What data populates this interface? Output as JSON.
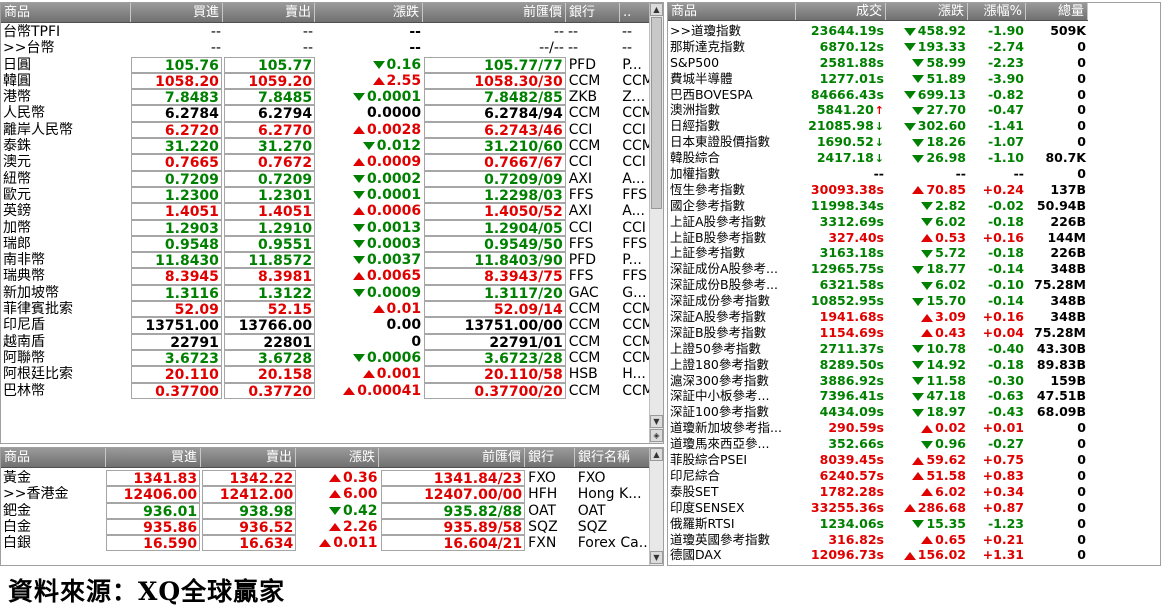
{
  "fx_panel": {
    "headers": [
      "商品",
      "買進",
      "賣出",
      "漲跌",
      "前匯價",
      "銀行",
      ".."
    ],
    "rows": [
      {
        "name": "台幣TPFI",
        "bid": "--",
        "ask": "--",
        "chg": "--",
        "prev": "--",
        "bank": "--",
        "bank2": "--",
        "dir": "none"
      },
      {
        "name": ">>台幣",
        "bid": "--",
        "ask": "--",
        "chg": "--",
        "prev": "--/--",
        "bank": "--",
        "bank2": "--",
        "dir": "none"
      },
      {
        "name": "日圓",
        "bid": "105.76",
        "ask": "105.77",
        "chg": "0.16",
        "prev": "105.77/77",
        "bank": "PFD",
        "bank2": "P...",
        "dir": "down"
      },
      {
        "name": "韓圓",
        "bid": "1058.20",
        "ask": "1059.20",
        "chg": "2.55",
        "prev": "1058.30/30",
        "bank": "CCM",
        "bank2": "CCM",
        "dir": "up"
      },
      {
        "name": "港幣",
        "bid": "7.8483",
        "ask": "7.8485",
        "chg": "0.0001",
        "prev": "7.8482/85",
        "bank": "ZKB",
        "bank2": "Z...",
        "dir": "down"
      },
      {
        "name": "人民幣",
        "bid": "6.2784",
        "ask": "6.2794",
        "chg": "0.0000",
        "prev": "6.2784/94",
        "bank": "CCM",
        "bank2": "CCM",
        "dir": "flat"
      },
      {
        "name": "離岸人民幣",
        "bid": "6.2720",
        "ask": "6.2770",
        "chg": "0.0028",
        "prev": "6.2743/46",
        "bank": "CCI",
        "bank2": "CCI",
        "dir": "up"
      },
      {
        "name": "泰銖",
        "bid": "31.220",
        "ask": "31.270",
        "chg": "0.012",
        "prev": "31.210/60",
        "bank": "CCM",
        "bank2": "CCM",
        "dir": "down"
      },
      {
        "name": "澳元",
        "bid": "0.7665",
        "ask": "0.7672",
        "chg": "0.0009",
        "prev": "0.7667/67",
        "bank": "CCI",
        "bank2": "CCI",
        "dir": "up"
      },
      {
        "name": "紐幣",
        "bid": "0.7209",
        "ask": "0.7209",
        "chg": "0.0002",
        "prev": "0.7209/09",
        "bank": "AXI",
        "bank2": "A...",
        "dir": "down"
      },
      {
        "name": "歐元",
        "bid": "1.2300",
        "ask": "1.2301",
        "chg": "0.0001",
        "prev": "1.2298/03",
        "bank": "FFS",
        "bank2": "FFS",
        "dir": "down"
      },
      {
        "name": "英鎊",
        "bid": "1.4051",
        "ask": "1.4051",
        "chg": "0.0006",
        "prev": "1.4050/52",
        "bank": "AXI",
        "bank2": "A...",
        "dir": "up"
      },
      {
        "name": "加幣",
        "bid": "1.2903",
        "ask": "1.2910",
        "chg": "0.0013",
        "prev": "1.2904/05",
        "bank": "CCI",
        "bank2": "CCI",
        "dir": "down"
      },
      {
        "name": "瑞郎",
        "bid": "0.9548",
        "ask": "0.9551",
        "chg": "0.0003",
        "prev": "0.9549/50",
        "bank": "FFS",
        "bank2": "FFS",
        "dir": "down"
      },
      {
        "name": "南非幣",
        "bid": "11.8430",
        "ask": "11.8572",
        "chg": "0.0037",
        "prev": "11.8403/90",
        "bank": "PFD",
        "bank2": "P...",
        "dir": "down"
      },
      {
        "name": "瑞典幣",
        "bid": "8.3945",
        "ask": "8.3981",
        "chg": "0.0065",
        "prev": "8.3943/75",
        "bank": "FFS",
        "bank2": "FFS",
        "dir": "up"
      },
      {
        "name": "新加坡幣",
        "bid": "1.3116",
        "ask": "1.3122",
        "chg": "0.0009",
        "prev": "1.3117/20",
        "bank": "GAC",
        "bank2": "G...",
        "dir": "down"
      },
      {
        "name": "菲律賓批索",
        "bid": "52.09",
        "ask": "52.15",
        "chg": "0.01",
        "prev": "52.09/14",
        "bank": "CCM",
        "bank2": "CCM",
        "dir": "up"
      },
      {
        "name": "印尼盾",
        "bid": "13751.00",
        "ask": "13766.00",
        "chg": "0.00",
        "prev": "13751.00/00",
        "bank": "CCM",
        "bank2": "CCM",
        "dir": "flat"
      },
      {
        "name": "越南盾",
        "bid": "22791",
        "ask": "22801",
        "chg": "0",
        "prev": "22791/01",
        "bank": "CCM",
        "bank2": "CCM",
        "dir": "flat"
      },
      {
        "name": "阿聯幣",
        "bid": "3.6723",
        "ask": "3.6728",
        "chg": "0.0006",
        "prev": "3.6723/28",
        "bank": "CCM",
        "bank2": "CCM",
        "dir": "down"
      },
      {
        "name": "阿根廷比索",
        "bid": "20.110",
        "ask": "20.158",
        "chg": "0.001",
        "prev": "20.110/58",
        "bank": "HSB",
        "bank2": "H...",
        "dir": "up"
      },
      {
        "name": "巴林幣",
        "bid": "0.37700",
        "ask": "0.37720",
        "chg": "0.00041",
        "prev": "0.37700/20",
        "bank": "CCM",
        "bank2": "CCM",
        "dir": "up"
      }
    ]
  },
  "metal_panel": {
    "headers": [
      "商品",
      "買進",
      "賣出",
      "漲跌",
      "前匯價",
      "銀行",
      "銀行名稱"
    ],
    "rows": [
      {
        "name": "黃金",
        "bid": "1341.83",
        "ask": "1342.22",
        "chg": "0.36",
        "prev": "1341.84/23",
        "bank": "FXO",
        "bank2": "FXO",
        "dir": "up"
      },
      {
        "name": ">>香港金",
        "bid": "12406.00",
        "ask": "12412.00",
        "chg": "6.00",
        "prev": "12407.00/00",
        "bank": "HFH",
        "bank2": "Hong K...",
        "dir": "up"
      },
      {
        "name": "鈀金",
        "bid": "936.01",
        "ask": "938.98",
        "chg": "0.42",
        "prev": "935.82/88",
        "bank": "OAT",
        "bank2": "OAT",
        "dir": "down"
      },
      {
        "name": "白金",
        "bid": "935.86",
        "ask": "936.52",
        "chg": "2.26",
        "prev": "935.89/58",
        "bank": "SQZ",
        "bank2": "SQZ",
        "dir": "up"
      },
      {
        "name": "白銀",
        "bid": "16.590",
        "ask": "16.634",
        "chg": "0.011",
        "prev": "16.604/21",
        "bank": "FXN",
        "bank2": "Forex Ca...",
        "dir": "up"
      }
    ]
  },
  "index_panel": {
    "headers": [
      "商品",
      "成交",
      "漲跌",
      "漲幅%",
      "總量"
    ],
    "rows": [
      {
        "name": ">>道瓊指數",
        "price": "23644.19s",
        "chg": "458.92",
        "pct": "-1.90",
        "vol": "509K",
        "dir": "down",
        "mark": ""
      },
      {
        "name": "那斯達克指數",
        "price": "6870.12s",
        "chg": "193.33",
        "pct": "-2.74",
        "vol": "0",
        "dir": "down",
        "mark": ""
      },
      {
        "name": "S&P500",
        "price": "2581.88s",
        "chg": "58.99",
        "pct": "-2.23",
        "vol": "0",
        "dir": "down",
        "mark": ""
      },
      {
        "name": "費城半導體",
        "price": "1277.01s",
        "chg": "51.89",
        "pct": "-3.90",
        "vol": "0",
        "dir": "down",
        "mark": ""
      },
      {
        "name": "巴西BOVESPA",
        "price": "84666.43s",
        "chg": "699.13",
        "pct": "-0.82",
        "vol": "0",
        "dir": "down",
        "mark": ""
      },
      {
        "name": "澳洲指數",
        "price": "5841.20",
        "chg": "27.70",
        "pct": "-0.47",
        "vol": "0",
        "dir": "down",
        "mark": "↑"
      },
      {
        "name": "日經指數",
        "price": "21085.98",
        "chg": "302.60",
        "pct": "-1.41",
        "vol": "0",
        "dir": "down",
        "mark": "↓"
      },
      {
        "name": "日本東證股價指數",
        "price": "1690.52",
        "chg": "18.26",
        "pct": "-1.07",
        "vol": "0",
        "dir": "down",
        "mark": "↓"
      },
      {
        "name": "韓股綜合",
        "price": "2417.18",
        "chg": "26.98",
        "pct": "-1.10",
        "vol": "80.7K",
        "dir": "down",
        "mark": "↓"
      },
      {
        "name": "加權指數",
        "price": "--",
        "chg": "--",
        "pct": "--",
        "vol": "0",
        "dir": "none",
        "mark": ""
      },
      {
        "name": "恆生參考指數",
        "price": "30093.38s",
        "chg": "70.85",
        "pct": "+0.24",
        "vol": "137B",
        "dir": "up",
        "mark": ""
      },
      {
        "name": "國企參考指數",
        "price": "11998.34s",
        "chg": "2.82",
        "pct": "-0.02",
        "vol": "50.94B",
        "dir": "down",
        "mark": ""
      },
      {
        "name": "上証A股參考指數",
        "price": "3312.69s",
        "chg": "6.02",
        "pct": "-0.18",
        "vol": "226B",
        "dir": "down",
        "mark": ""
      },
      {
        "name": "上証B股參考指數",
        "price": "327.40s",
        "chg": "0.53",
        "pct": "+0.16",
        "vol": "144M",
        "dir": "up",
        "mark": ""
      },
      {
        "name": "上証參考指數",
        "price": "3163.18s",
        "chg": "5.72",
        "pct": "-0.18",
        "vol": "226B",
        "dir": "down",
        "mark": ""
      },
      {
        "name": "深証成份A股參考...",
        "price": "12965.75s",
        "chg": "18.77",
        "pct": "-0.14",
        "vol": "348B",
        "dir": "down",
        "mark": ""
      },
      {
        "name": "深証成份B股參考...",
        "price": "6321.58s",
        "chg": "6.02",
        "pct": "-0.10",
        "vol": "75.28M",
        "dir": "down",
        "mark": ""
      },
      {
        "name": "深証成份參考指數",
        "price": "10852.95s",
        "chg": "15.70",
        "pct": "-0.14",
        "vol": "348B",
        "dir": "down",
        "mark": ""
      },
      {
        "name": "深証A股參考指數",
        "price": "1941.68s",
        "chg": "3.09",
        "pct": "+0.16",
        "vol": "348B",
        "dir": "up",
        "mark": ""
      },
      {
        "name": "深証B股參考指數",
        "price": "1154.69s",
        "chg": "0.43",
        "pct": "+0.04",
        "vol": "75.28M",
        "dir": "up",
        "mark": ""
      },
      {
        "name": "上證50參考指數",
        "price": "2711.37s",
        "chg": "10.78",
        "pct": "-0.40",
        "vol": "43.30B",
        "dir": "down",
        "mark": ""
      },
      {
        "name": "上證180參考指數",
        "price": "8289.50s",
        "chg": "14.92",
        "pct": "-0.18",
        "vol": "89.83B",
        "dir": "down",
        "mark": ""
      },
      {
        "name": "滬深300參考指數",
        "price": "3886.92s",
        "chg": "11.58",
        "pct": "-0.30",
        "vol": "159B",
        "dir": "down",
        "mark": ""
      },
      {
        "name": "深証中小板參考...",
        "price": "7396.41s",
        "chg": "47.18",
        "pct": "-0.63",
        "vol": "47.51B",
        "dir": "down",
        "mark": ""
      },
      {
        "name": "深証100參考指數",
        "price": "4434.09s",
        "chg": "18.97",
        "pct": "-0.43",
        "vol": "68.09B",
        "dir": "down",
        "mark": ""
      },
      {
        "name": "道瓊新加坡參考指...",
        "price": "290.59s",
        "chg": "0.02",
        "pct": "+0.01",
        "vol": "0",
        "dir": "up",
        "mark": ""
      },
      {
        "name": "道瓊馬來西亞參...",
        "price": "352.66s",
        "chg": "0.96",
        "pct": "-0.27",
        "vol": "0",
        "dir": "down",
        "mark": ""
      },
      {
        "name": "菲股綜合PSEI",
        "price": "8039.45s",
        "chg": "59.62",
        "pct": "+0.75",
        "vol": "0",
        "dir": "up",
        "mark": ""
      },
      {
        "name": "印尼綜合",
        "price": "6240.57s",
        "chg": "51.58",
        "pct": "+0.83",
        "vol": "0",
        "dir": "up",
        "mark": ""
      },
      {
        "name": "泰股SET",
        "price": "1782.28s",
        "chg": "6.02",
        "pct": "+0.34",
        "vol": "0",
        "dir": "up",
        "mark": ""
      },
      {
        "name": "印度SENSEX",
        "price": "33255.36s",
        "chg": "286.68",
        "pct": "+0.87",
        "vol": "0",
        "dir": "up",
        "mark": ""
      },
      {
        "name": "俄羅斯RTSI",
        "price": "1234.06s",
        "chg": "15.35",
        "pct": "-1.23",
        "vol": "0",
        "dir": "down",
        "mark": ""
      },
      {
        "name": "道瓊英國參考指數",
        "price": "316.82s",
        "chg": "0.65",
        "pct": "+0.21",
        "vol": "0",
        "dir": "up",
        "mark": ""
      },
      {
        "name": "德國DAX",
        "price": "12096.73s",
        "chg": "156.02",
        "pct": "+1.31",
        "vol": "0",
        "dir": "up",
        "mark": ""
      }
    ]
  },
  "footer": {
    "source": "資料來源：XQ全球贏家"
  },
  "colors": {
    "up": "#e00000",
    "down": "#008000",
    "header": "#808080"
  }
}
